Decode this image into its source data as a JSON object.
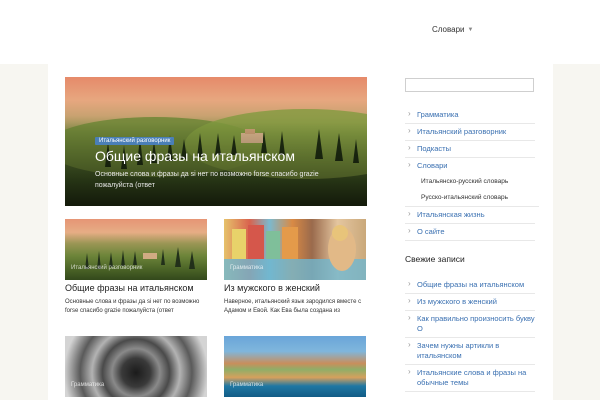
{
  "nav": {
    "item": "Словари"
  },
  "hero": {
    "tag": "Итальянский разговорник",
    "title": "Общие фразы на итальянском",
    "excerpt": "Основные слова и фразы да si нет по возможно forse спасибо grazie пожалуйста (ответ"
  },
  "cards": [
    {
      "category": "Итальянский разговорник",
      "title": "Общие фразы на итальянском",
      "excerpt": "Основные слова и фразы да si нет по возможно forse спасибо grazie пожалуйста (ответ"
    },
    {
      "category": "Грамматика",
      "title": "Из мужского в женский",
      "excerpt": "Наверное, итальянский язык зародился вместе с Адамом и Евой. Как Ева была создана из"
    },
    {
      "category": "Грамматика"
    },
    {
      "category": "Грамматика"
    }
  ],
  "sidebar": {
    "menu": [
      "Грамматика",
      "Итальянский разговорник",
      "Подкасты",
      "Словари",
      "Итальянско-русский словарь",
      "Русско-итальянский словарь",
      "Итальянская жизнь",
      "О сайте"
    ],
    "recent_title": "Свежие записи",
    "recent": [
      "Общие фразы на итальянском",
      "Из мужского в женский",
      "Как правильно произносить букву О",
      "Зачем нужны артикли в итальянском",
      "Итальянские слова и фразы на обычные темы"
    ]
  }
}
